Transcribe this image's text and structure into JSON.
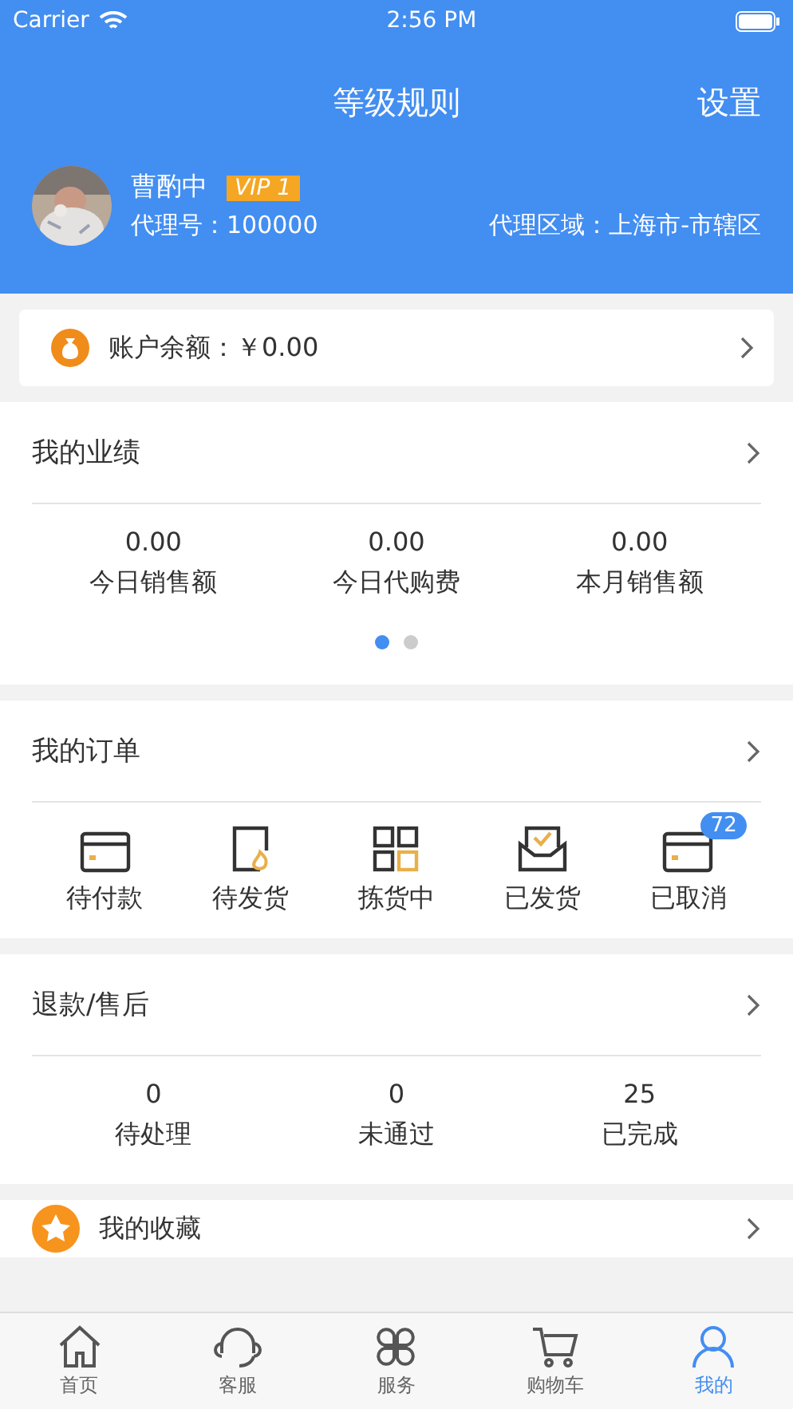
{
  "status_bar": {
    "carrier": "Carrier",
    "time": "2:56 PM"
  },
  "header": {
    "title": "等级规则",
    "action": "设置"
  },
  "profile": {
    "name": "曹酌中",
    "badge": "VIP 1",
    "agent_id": "代理号：100000",
    "region": "代理区域：上海市-市辖区"
  },
  "balance": {
    "label": "账户余额：￥0.00"
  },
  "performance": {
    "title": "我的业绩",
    "stats": [
      {
        "value": "0.00",
        "label": "今日销售额"
      },
      {
        "value": "0.00",
        "label": "今日代购费"
      },
      {
        "value": "0.00",
        "label": "本月销售额"
      }
    ],
    "pages": [
      {
        "selected": true
      },
      {
        "selected": false
      }
    ]
  },
  "orders": {
    "title": "我的订单",
    "items": [
      {
        "kind": "card",
        "label": "待付款"
      },
      {
        "kind": "tablet",
        "label": "待发货"
      },
      {
        "kind": "grid",
        "label": "拣货中"
      },
      {
        "kind": "inbox",
        "label": "已发货"
      },
      {
        "kind": "card",
        "label": "已取消",
        "badge": "72"
      }
    ]
  },
  "refunds": {
    "title": "退款/售后",
    "stats": [
      {
        "value": "0",
        "label": "待处理"
      },
      {
        "value": "0",
        "label": "未通过"
      },
      {
        "value": "25",
        "label": "已完成"
      }
    ]
  },
  "favorites": {
    "title": "我的收藏"
  },
  "tab_bar": [
    {
      "kind": "home",
      "label": "首页",
      "selected": false
    },
    {
      "kind": "support",
      "label": "客服",
      "selected": false
    },
    {
      "kind": "services",
      "label": "服务",
      "selected": false
    },
    {
      "kind": "cart",
      "label": "购物车",
      "selected": false
    },
    {
      "kind": "user",
      "label": "我的",
      "selected": true
    }
  ]
}
